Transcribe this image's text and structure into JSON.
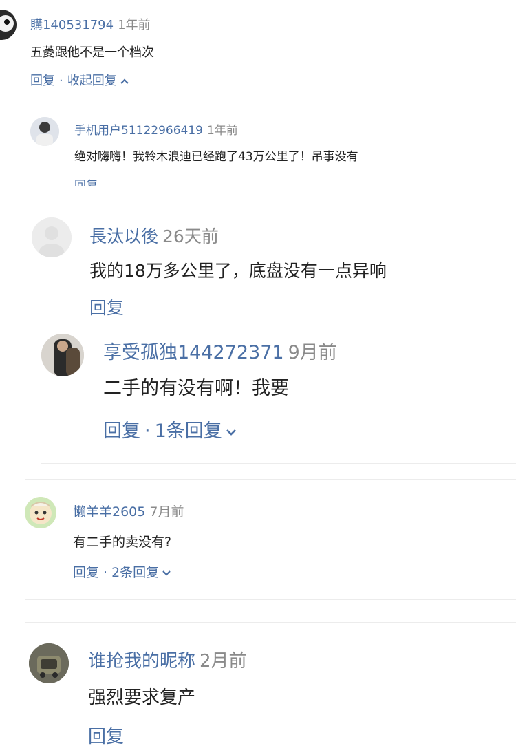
{
  "comments": [
    {
      "user": "購140531794",
      "time": "1年前",
      "text": "五菱跟他不是一个档次",
      "reply_label": "回复",
      "more_label": "收起回复",
      "more_icon": "chevron-up-icon"
    },
    {
      "user": "手机用户51122966419",
      "time": "1年前",
      "text": "绝对嗨嗨！我铃木浪迪已经跑了43万公里了！吊事没有",
      "reply_label": "回复"
    },
    {
      "user": "長汰以後",
      "time": "26天前",
      "text": "我的18万多公里了，底盘没有一点异响",
      "reply_label": "回复"
    },
    {
      "user": "享受孤独144272371",
      "time": "9月前",
      "text": "二手的有没有啊！我要",
      "reply_label": "回复",
      "more_label": "1条回复",
      "more_icon": "chevron-down-icon"
    },
    {
      "user": "懒羊羊2605",
      "time": "7月前",
      "text": "有二手的卖没有?",
      "reply_label": "回复",
      "more_label": "2条回复",
      "more_icon": "chevron-down-icon"
    },
    {
      "user": "谁抢我的昵称",
      "time": "2月前",
      "text": "强烈要求复产",
      "reply_label": "回复"
    }
  ],
  "colors": {
    "link": "#4a6fa5",
    "time": "#8a8a8a",
    "text": "#222222",
    "divider": "#ececec"
  }
}
